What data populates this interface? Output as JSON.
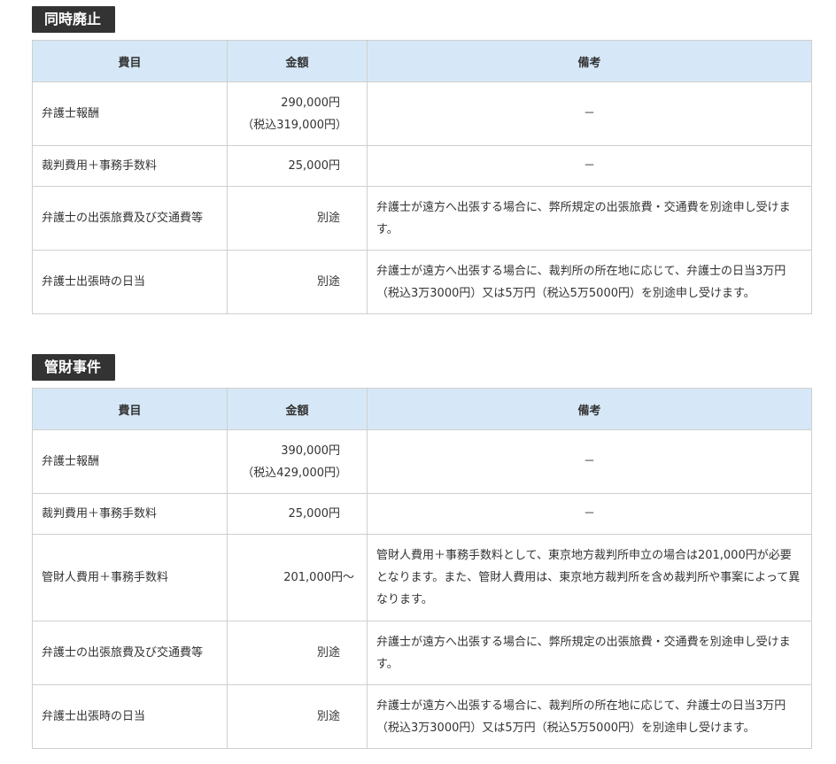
{
  "section1": {
    "title": "同時廃止",
    "headers": {
      "item": "費目",
      "amount": "金額",
      "note": "備考"
    },
    "rows": [
      {
        "item": "弁護士報酬",
        "amount": "290,000円",
        "amount_sub": "（税込319,000円）",
        "note": "－"
      },
      {
        "item": "裁判費用＋事務手数料",
        "amount": "25,000円",
        "note": "－"
      },
      {
        "item": "弁護士の出張旅費及び交通費等",
        "amount": "別途",
        "note": "弁護士が遠方へ出張する場合に、弊所規定の出張旅費・交通費を別途申し受けます。"
      },
      {
        "item": "弁護士出張時の日当",
        "amount": "別途",
        "note": "弁護士が遠方へ出張する場合に、裁判所の所在地に応じて、弁護士の日当3万円（税込3万3000円）又は5万円（税込5万5000円）を別途申し受けます。"
      }
    ]
  },
  "section2": {
    "title": "管財事件",
    "headers": {
      "item": "費目",
      "amount": "金額",
      "note": "備考"
    },
    "rows": [
      {
        "item": "弁護士報酬",
        "amount": "390,000円",
        "amount_sub": "（税込429,000円）",
        "note": "－"
      },
      {
        "item": "裁判費用＋事務手数料",
        "amount": "25,000円",
        "note": "－"
      },
      {
        "item": "管財人費用＋事務手数料",
        "amount": "201,000円～",
        "note": "管財人費用＋事務手数料として、東京地方裁判所申立の場合は201,000円が必要となります。また、管財人費用は、東京地方裁判所を含め裁判所や事案によって異なります。"
      },
      {
        "item": "弁護士の出張旅費及び交通費等",
        "amount": "別途",
        "note": "弁護士が遠方へ出張する場合に、弊所規定の出張旅費・交通費を別途申し受けます。"
      },
      {
        "item": "弁護士出張時の日当",
        "amount": "別途",
        "note": "弁護士が遠方へ出張する場合に、裁判所の所在地に応じて、弁護士の日当3万円（税込3万3000円）又は5万円（税込5万5000円）を別途申し受けます。"
      }
    ]
  }
}
